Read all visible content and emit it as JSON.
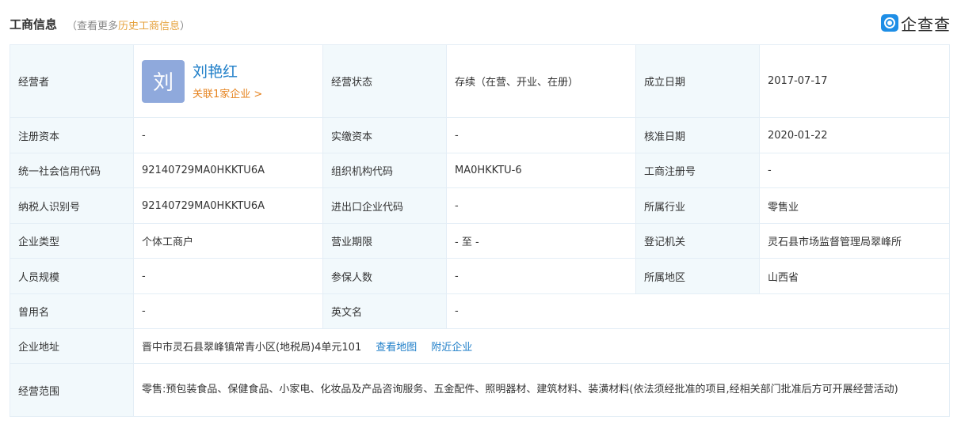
{
  "header": {
    "title": "工商信息",
    "sub_prefix": "（查看更多",
    "sub_link": "历史工商信息",
    "sub_suffix": "）",
    "logo_text": "企查查"
  },
  "owner": {
    "label": "经营者",
    "avatar_char": "刘",
    "name": "刘艳红",
    "related": "关联1家企业 >"
  },
  "rows": {
    "status_k": "经营状态",
    "status_v": "存续（在营、开业、在册）",
    "estab_k": "成立日期",
    "estab_v": "2017-07-17",
    "regcap_k": "注册资本",
    "regcap_v": "-",
    "paidcap_k": "实缴资本",
    "paidcap_v": "-",
    "approve_k": "核准日期",
    "approve_v": "2020-01-22",
    "credit_k": "统一社会信用代码",
    "credit_v": "92140729MA0HKKTU6A",
    "org_k": "组织机构代码",
    "org_v": "MA0HKKTU-6",
    "regno_k": "工商注册号",
    "regno_v": "-",
    "tax_k": "纳税人识别号",
    "tax_v": "92140729MA0HKKTU6A",
    "ie_k": "进出口企业代码",
    "ie_v": "-",
    "industry_k": "所属行业",
    "industry_v": "零售业",
    "type_k": "企业类型",
    "type_v": "个体工商户",
    "term_k": "营业期限",
    "term_v": "- 至 -",
    "authority_k": "登记机关",
    "authority_v": "灵石县市场监督管理局翠峰所",
    "staff_k": "人员规模",
    "staff_v": "-",
    "insured_k": "参保人数",
    "insured_v": "-",
    "region_k": "所属地区",
    "region_v": "山西省",
    "former_k": "曾用名",
    "former_v": "-",
    "en_k": "英文名",
    "en_v": "-",
    "addr_k": "企业地址",
    "addr_v": "晋中市灵石县翠峰镇常青小区(地税局)4单元101",
    "addr_map": "查看地图",
    "addr_nearby": "附近企业",
    "scope_k": "经营范围",
    "scope_v": "零售:预包装食品、保健食品、小家电、化妆品及产品咨询服务、五金配件、照明器材、建筑材料、装潢材料(依法须经批准的项目,经相关部门批准后方可开展经营活动)"
  }
}
